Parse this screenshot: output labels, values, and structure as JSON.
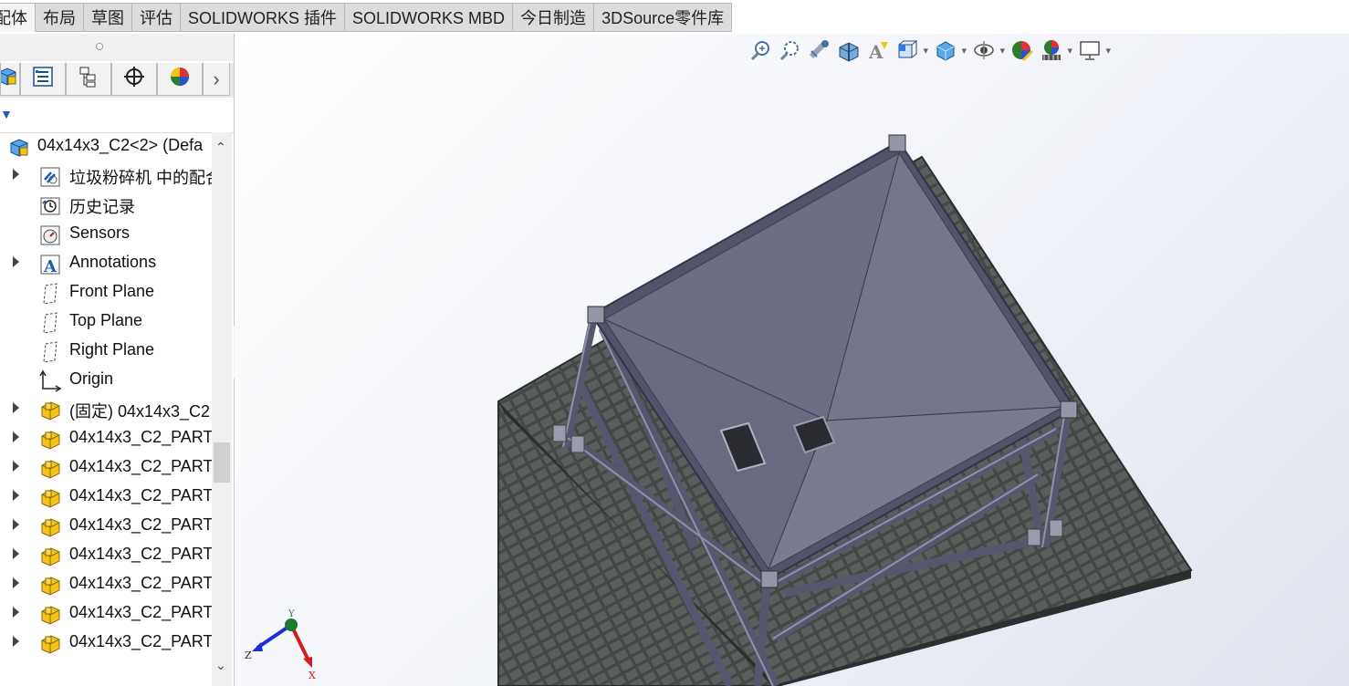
{
  "tabs": [
    "配体",
    "布局",
    "草图",
    "评估",
    "SOLIDWORKS 插件",
    "SOLIDWORKS MBD",
    "今日制造",
    "3DSource零件库"
  ],
  "active_tab": 0,
  "feature_manager": {
    "tab_icons": [
      "assembly-icon",
      "property-manager-icon",
      "configuration-manager-icon",
      "dimxpert-icon",
      "display-manager-icon"
    ],
    "root": "04x14x3_C2<2> (Defa",
    "items": [
      {
        "label": "垃圾粉碎机 中的配合",
        "icon": "mates-icon",
        "expand": true
      },
      {
        "label": "历史记录",
        "icon": "history-icon",
        "expand": false
      },
      {
        "label": "Sensors",
        "icon": "sensors-icon",
        "expand": false
      },
      {
        "label": "Annotations",
        "icon": "annotations-icon",
        "expand": true
      },
      {
        "label": "Front Plane",
        "icon": "plane-icon",
        "expand": false
      },
      {
        "label": "Top Plane",
        "icon": "plane-icon",
        "expand": false
      },
      {
        "label": "Right Plane",
        "icon": "plane-icon",
        "expand": false
      },
      {
        "label": "Origin",
        "icon": "origin-icon",
        "expand": false
      },
      {
        "label": "(固定) 04x14x3_C2",
        "icon": "part-icon",
        "expand": true
      },
      {
        "label": "04x14x3_C2_PART",
        "icon": "part-icon",
        "expand": true
      },
      {
        "label": "04x14x3_C2_PART",
        "icon": "part-icon",
        "expand": true
      },
      {
        "label": "04x14x3_C2_PART",
        "icon": "part-icon",
        "expand": true
      },
      {
        "label": "04x14x3_C2_PART",
        "icon": "part-icon",
        "expand": true
      },
      {
        "label": "04x14x3_C2_PART",
        "icon": "part-icon",
        "expand": true
      },
      {
        "label": "04x14x3_C2_PART",
        "icon": "part-icon",
        "expand": true
      },
      {
        "label": "04x14x3_C2_PART",
        "icon": "part-icon",
        "expand": true
      },
      {
        "label": "04x14x3_C2_PART",
        "icon": "part-icon",
        "expand": true
      }
    ]
  },
  "heads_up_toolbar": [
    "zoom-to-fit-icon",
    "zoom-to-area-icon",
    "previous-view-icon",
    "section-view-icon",
    "dynamic-annotation-icon",
    "view-orientation-icon",
    "display-style-icon",
    "hide-show-icon",
    "edit-appearance-icon",
    "apply-scene-icon",
    "view-settings-icon"
  ],
  "triad": {
    "y": "Y",
    "z": "Z",
    "x": "X"
  },
  "colors": {
    "accent": "#1c5db5",
    "part_yellow": "#f2c31b",
    "model_steel": "#6a6c82",
    "paving": "#4d5150"
  }
}
